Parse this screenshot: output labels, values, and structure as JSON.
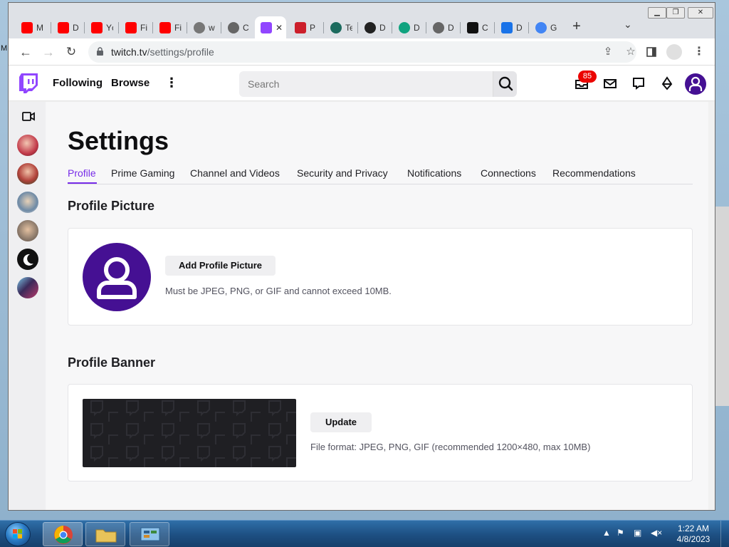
{
  "desktop": {
    "edge_label": "M"
  },
  "tabs": [
    {
      "title": "M",
      "color": "#ff0000"
    },
    {
      "title": "D",
      "color": "#ff0000"
    },
    {
      "title": "Yc",
      "color": "#ff0000"
    },
    {
      "title": "Fi",
      "color": "#ff0000"
    },
    {
      "title": "Fi",
      "color": "#ff0000"
    },
    {
      "title": "w",
      "color": "#777777"
    },
    {
      "title": "C",
      "color": "#666666"
    },
    {
      "title": "",
      "color": "#9146ff",
      "active": true
    },
    {
      "title": "P",
      "color": "#cc1f2b"
    },
    {
      "title": "Te",
      "color": "#1c6b5e"
    },
    {
      "title": "D",
      "color": "#222222"
    },
    {
      "title": "D",
      "color": "#10a37f"
    },
    {
      "title": "D",
      "color": "#666666"
    },
    {
      "title": "C",
      "color": "#111111"
    },
    {
      "title": "D",
      "color": "#1a73e8"
    },
    {
      "title": "G",
      "color": "#4285f4"
    }
  ],
  "active_tab_close": "✕",
  "new_tab": "+",
  "address": {
    "host": "twitch.tv",
    "path": "/settings/profile"
  },
  "twitch": {
    "nav": {
      "following": "Following",
      "browse": "Browse"
    },
    "search_placeholder": "Search",
    "notification_count": "85",
    "colors": {
      "brand": "#9146ff",
      "accent": "#772ce8",
      "avatar": "#451093",
      "badge": "#eb0400"
    }
  },
  "sidebar": {
    "channels": [
      {
        "name": "channel-1",
        "color": "#c23a4a"
      },
      {
        "name": "channel-2",
        "color": "#b1423b"
      },
      {
        "name": "channel-3",
        "color": "#6e8aa6"
      },
      {
        "name": "channel-4",
        "color": "#8c7a6b"
      },
      {
        "name": "channel-5",
        "color": "#111111"
      },
      {
        "name": "channel-6",
        "color": "#3b2a5a"
      }
    ]
  },
  "settings": {
    "title": "Settings",
    "tabs": [
      "Profile",
      "Prime Gaming",
      "Channel and Videos",
      "Security and Privacy",
      "Notifications",
      "Connections",
      "Recommendations"
    ],
    "profile_picture": {
      "heading": "Profile Picture",
      "button": "Add Profile Picture",
      "hint": "Must be JPEG, PNG, or GIF and cannot exceed 10MB."
    },
    "profile_banner": {
      "heading": "Profile Banner",
      "button": "Update",
      "hint": "File format: JPEG, PNG, GIF (recommended 1200×480, max 10MB)"
    }
  },
  "taskbar": {
    "clock_time": "1:22 AM",
    "clock_date": "4/8/2023"
  }
}
